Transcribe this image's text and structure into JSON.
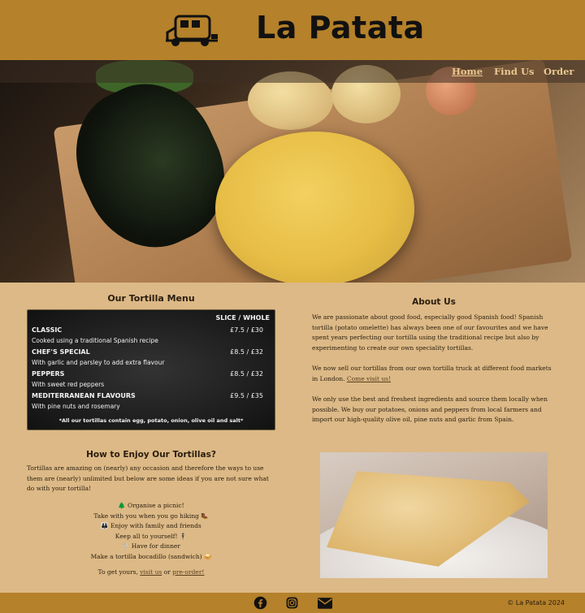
{
  "site": {
    "brand": "La Patata",
    "copyright": "© La Patata 2024",
    "accent": "#b5812a",
    "background": "#dcb986"
  },
  "nav": {
    "items": [
      "Home",
      "Find Us",
      "Order"
    ],
    "active": "Home"
  },
  "menu": {
    "title": "Our Tortilla Menu",
    "header": "SLICE / WHOLE",
    "items": [
      {
        "name": "CLASSIC",
        "price": "£7.5 / £30",
        "desc": "Cooked using a traditional Spanish recipe"
      },
      {
        "name": "CHEF'S SPECIAL",
        "price": "£8.5 / £32",
        "desc": "With garlic and parsley to add extra flavour"
      },
      {
        "name": "PEPPERS",
        "price": "£8.5 / £32",
        "desc": "With sweet red peppers"
      },
      {
        "name": "MEDITERRANEAN FLAVOURS",
        "price": "£9.5 / £35",
        "desc": "With pine nuts and rosemary"
      }
    ],
    "note": "*All our tortillas contain egg, potato, onion, olive oil and salt*"
  },
  "about": {
    "title": "About Us",
    "p1": "We are passionate about good food, especially good Spanish food! Spanish tortilla (potato omelette) has always been one of our favourites and we have spent years perfecting our tortilla using the traditional recipe but also by experimenting to create our own speciality tortillas.",
    "p2_text": "We now sell our tortillas from our own tortilla truck at different food markets in London. ",
    "p2_link": "Come visit us!",
    "p3": "We only use the best and freshest ingredients and source them locally when possible. We buy our potatoes, onions and peppers from local farmers and import our high-quality olive oil, pine nuts and garlic from Spain."
  },
  "enjoy": {
    "title": "How to Enjoy Our Tortillas?",
    "intro": "Tortillas are amazing on (nearly) any occasion and therefore the ways to use them are (nearly) unlimited but below are some ideas if you are not sure what do with your tortilla!",
    "ideas": [
      "🌲 Organise a picnic!",
      "Take with you when you go hiking 🥾",
      "👪 Enjoy with family and friends",
      "Keep all to yourself! 🕴",
      "🍴 Have for dinner",
      "Make a tortilla bocadillo (sandwich) 🥪"
    ],
    "cta_prefix": "To get yours, ",
    "cta_link1": "visit us",
    "cta_mid": " or ",
    "cta_link2": "pre-order!"
  },
  "footer_icons": [
    "facebook-icon",
    "instagram-icon",
    "envelope-icon"
  ]
}
